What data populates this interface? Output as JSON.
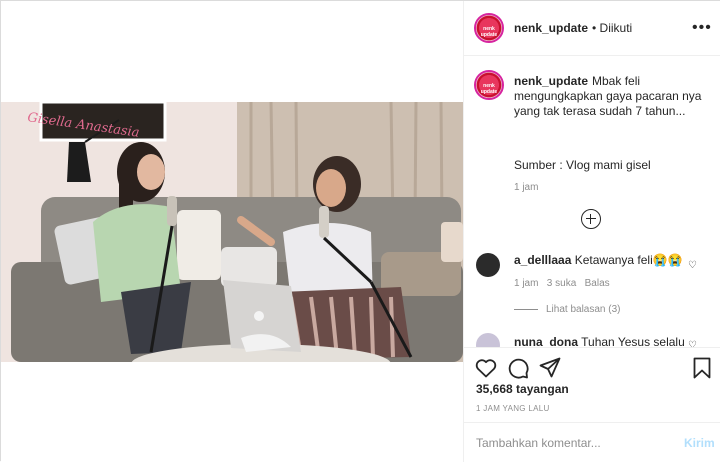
{
  "post": {
    "author": "nenk_update",
    "follow_status": "Diikuti",
    "avatar_label": "nenk update",
    "more_icon": "more-horizontal-icon"
  },
  "video": {
    "watermark": "Gisella Anastasia"
  },
  "caption": {
    "author": "nenk_update",
    "text": "Mbak feli mengungkapkan gaya pacaran nya yang tak terasa sudah 7 tahun...",
    "source": "Sumber : Vlog mami gisel",
    "time": "1 jam"
  },
  "comments": [
    {
      "author": "a_delllaaa",
      "text": "Ketawanya feli😭😭",
      "time": "1 jam",
      "likes": "3 suka",
      "reply": "Balas",
      "view_replies": "Lihat balasan (3)"
    },
    {
      "author": "nuna_dona",
      "text": "Tuhan Yesus selalu"
    }
  ],
  "stats": {
    "views": "35,668 tayangan",
    "posted": "1 JAM YANG LALU"
  },
  "composer": {
    "placeholder": "Tambahkan komentar...",
    "send": "Kirim"
  }
}
